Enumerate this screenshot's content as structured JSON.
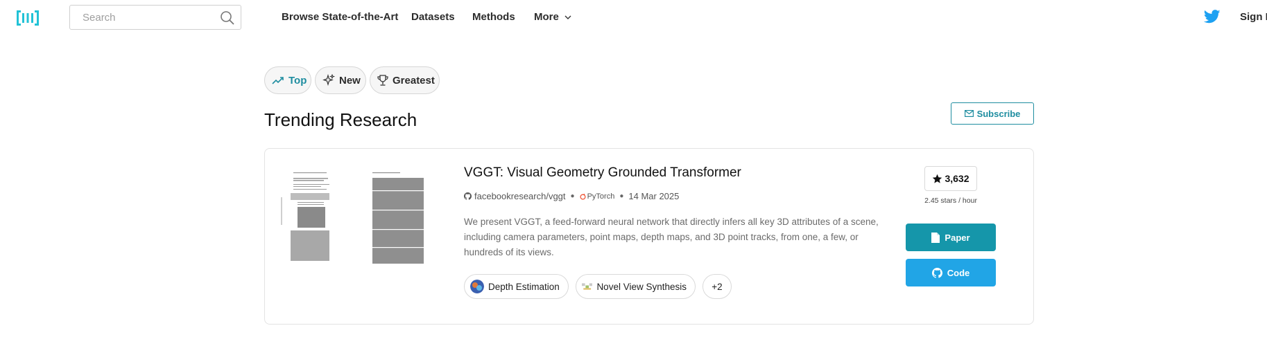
{
  "nav": {
    "search_placeholder": "Search",
    "links": [
      "Browse State-of-the-Art",
      "Datasets",
      "Methods",
      "More"
    ],
    "sign_in": "Sign In"
  },
  "filters": [
    {
      "label": "Top",
      "icon": "trending-up-icon",
      "active": true
    },
    {
      "label": "New",
      "icon": "sparkle-icon",
      "active": false
    },
    {
      "label": "Greatest",
      "icon": "trophy-icon",
      "active": false
    }
  ],
  "section": {
    "title": "Trending Research",
    "subscribe": "Subscribe"
  },
  "paper": {
    "title": "VGGT: Visual Geometry Grounded Transformer",
    "repo": "facebookresearch/vggt",
    "framework": "PyTorch",
    "date": "14 Mar 2025",
    "abstract": "We present VGGT, a feed-forward neural network that directly infers all key 3D attributes of a scene, including camera parameters, point maps, depth maps, and 3D point tracks, from one, a few, or hundreds of its views.",
    "tasks": [
      "Depth Estimation",
      "Novel View Synthesis"
    ],
    "more_tasks": "+2",
    "stars": "3,632",
    "stars_rate": "2.45 stars / hour",
    "paper_btn": "Paper",
    "code_btn": "Code"
  },
  "colors": {
    "accent": "#1e8da0",
    "paper_button": "#1596aa",
    "code_button": "#21a5e6",
    "twitter": "#1da1f2"
  }
}
